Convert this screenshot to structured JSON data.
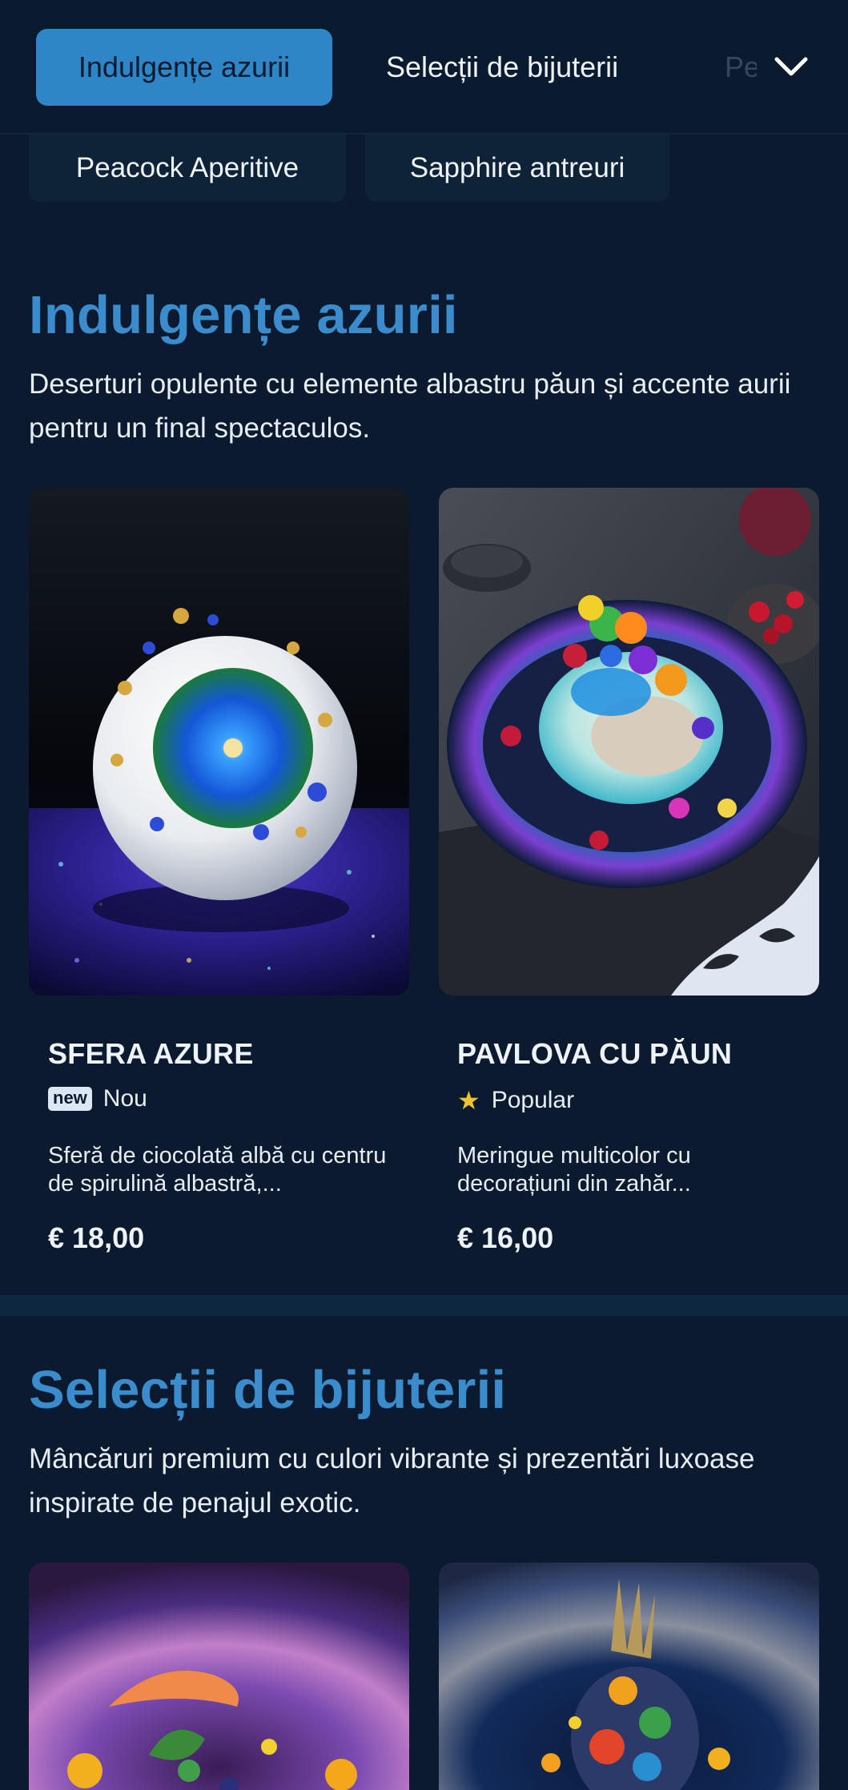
{
  "nav": {
    "tabs": [
      {
        "label": "Indulgențe azurii",
        "active": true
      },
      {
        "label": "Selecții de bijuterii",
        "active": false
      },
      {
        "label": "Peacock",
        "active": false
      }
    ],
    "more_icon": "chevron-down-icon"
  },
  "subnav": {
    "items": [
      {
        "label": "Peacock Aperitive"
      },
      {
        "label": "Sapphire antreuri"
      }
    ]
  },
  "sections": [
    {
      "title": "Indulgențe azurii",
      "description": "Deserturi opulente cu elemente albastru păun și accente aurii pentru un final spectaculos.",
      "items": [
        {
          "name": "SFERA AZURE",
          "badge_pill": "new",
          "badge_label": "Nou",
          "description": "Sferă de ciocolată albă cu centru de spirulină albastră,...",
          "price": "€ 18,00"
        },
        {
          "name": "PAVLOVA CU PĂUN",
          "badge_icon": "star-icon",
          "badge_label": "Popular",
          "description": "Meringue multicolor cu decorațiuni din zahăr...",
          "price": "€ 16,00"
        }
      ]
    },
    {
      "title": "Selecții de bijuterii",
      "description": "Mâncăruri premium cu culori vibrante și prezentări luxoase inspirate de penajul exotic."
    }
  ],
  "colors": {
    "background": "#0b1a2e",
    "accent": "#3a8ccc",
    "active_tab": "#2f86c6",
    "star": "#f2c12e"
  }
}
